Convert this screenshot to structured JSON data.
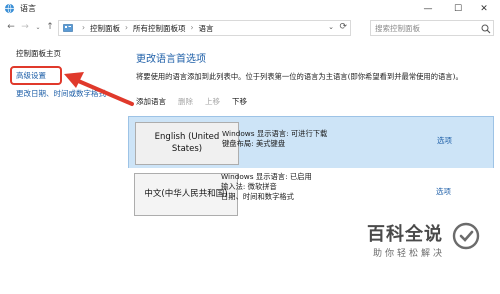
{
  "window": {
    "title": "语言",
    "icon": "language-globe-icon",
    "controls": {
      "minimize": "—",
      "maximize": "☐",
      "close": "✕"
    }
  },
  "address_bar": {
    "nav": {
      "back": "←",
      "forward": "→",
      "dropdown": "⌄",
      "up": "↑"
    },
    "breadcrumbs": [
      "控制面板",
      "所有控制面板项",
      "语言"
    ],
    "separator": "›",
    "dropdown": "⌄",
    "refresh": "⟳"
  },
  "search": {
    "placeholder": "搜索控制面板"
  },
  "sidebar": {
    "items": [
      {
        "label": "控制面板主页"
      },
      {
        "label": "高级设置"
      },
      {
        "label": "更改日期、时间或数字格式"
      }
    ]
  },
  "main": {
    "title": "更改语言首选项",
    "description": "将要使用的语言添加到此列表中。位于列表第一位的语言为主语言(即你希望看到并最常使用的语言)。",
    "toolbar": [
      {
        "label": "添加语言",
        "enabled": true
      },
      {
        "label": "删除",
        "enabled": false
      },
      {
        "label": "上移",
        "enabled": false
      },
      {
        "label": "下移",
        "enabled": true
      }
    ],
    "languages": [
      {
        "name": "English (United States)",
        "info": [
          "Windows 显示语言: 可进行下载",
          "键盘布局: 美式键盘"
        ],
        "options_label": "选项",
        "selected": true
      },
      {
        "name": "中文(中华人民共和国)",
        "info": [
          "Windows 显示语言: 已启用",
          "输入法: 微软拼音",
          "日期、时间和数字格式"
        ],
        "options_label": "选项",
        "selected": false
      }
    ]
  },
  "watermark": {
    "text": "百科全说",
    "subtext": "助你轻松解决"
  },
  "colors": {
    "link": "#1e5fa8",
    "selected_row": "#cde4f7",
    "annotation": "#e0392b"
  }
}
